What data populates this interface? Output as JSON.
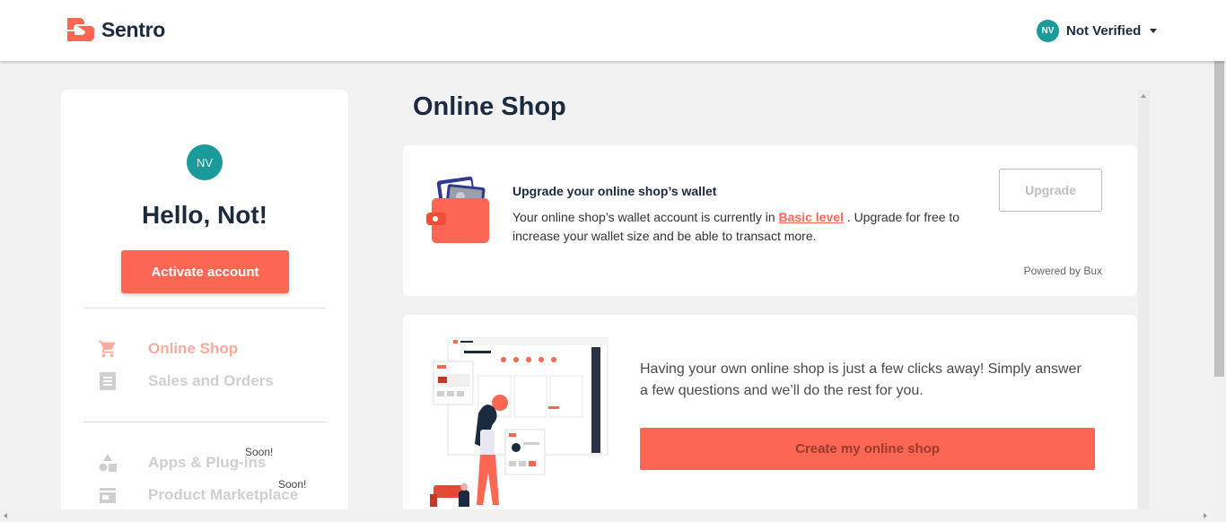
{
  "header": {
    "brand_name": "Sentro",
    "user_initials": "NV",
    "user_label": "Not Verified"
  },
  "sidebar": {
    "avatar_initials": "NV",
    "greeting": "Hello, Not!",
    "activate_label": "Activate account",
    "items": [
      {
        "label": "Online Shop",
        "icon": "cart-icon",
        "active": true
      },
      {
        "label": "Sales and Orders",
        "icon": "receipt-icon",
        "active": false
      },
      {
        "label": "Apps & Plug-ins",
        "icon": "apps-icon",
        "badge": "Soon!"
      },
      {
        "label": "Product Marketplace",
        "icon": "store-icon",
        "badge": "Soon!"
      }
    ]
  },
  "main": {
    "title": "Online Shop",
    "wallet": {
      "title": "Upgrade your online shop’s wallet",
      "desc_prefix": "Your online shop’s wallet account is currently in ",
      "level_link": "Basic level",
      "desc_suffix": " . Upgrade for free to increase your wallet size and be able to transact more.",
      "upgrade_label": "Upgrade",
      "powered_by": "Powered by Bux"
    },
    "promo": {
      "text": "Having your own online shop is just a few clicks away! Simply answer a few questions and we’ll do the rest for you.",
      "cta_label": "Create my online shop"
    }
  },
  "colors": {
    "accent": "#fb6753",
    "teal": "#1a9a98",
    "navy": "#1b2a3f"
  }
}
